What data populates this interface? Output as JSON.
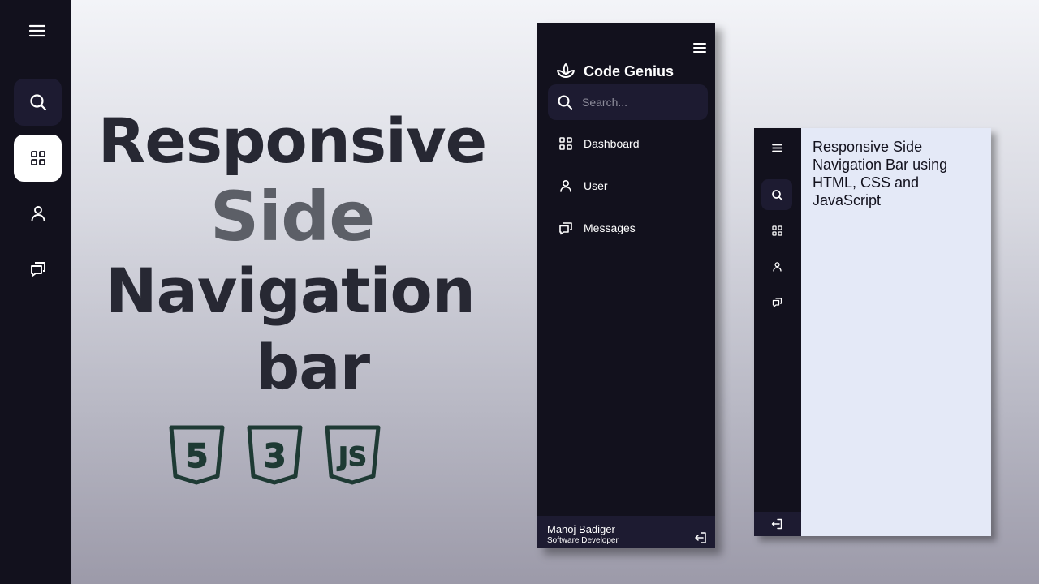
{
  "colors": {
    "sidebar": "#12111d",
    "sidebar_highlight": "#1d1b31",
    "active_item": "#ffffff",
    "app_background": "#e4e9f7",
    "title_dark": "#272833",
    "title_gray": "#5c5f67",
    "tech_badges": "#1e3a34"
  },
  "rail": {
    "icons": [
      "menu-icon",
      "search-icon",
      "dashboard-icon",
      "user-icon",
      "messages-icon"
    ],
    "active": "dashboard"
  },
  "hero": {
    "line1": "Responsive",
    "line2": "Side",
    "line3": "Navigation",
    "line4": "bar",
    "tech_badges": [
      "5",
      "3",
      "JS"
    ]
  },
  "expanded_sidebar": {
    "brand": "Code Genius",
    "search_placeholder": "Search...",
    "items": [
      {
        "label": "Dashboard",
        "icon": "dashboard-icon"
      },
      {
        "label": "User",
        "icon": "user-icon"
      },
      {
        "label": "Messages",
        "icon": "messages-icon"
      }
    ],
    "profile": {
      "name": "Manoj Badiger",
      "role": "Software Developer"
    }
  },
  "collapsed_app": {
    "content_text": "Responsive Side Navigation Bar using HTML, CSS and JavaScript"
  }
}
